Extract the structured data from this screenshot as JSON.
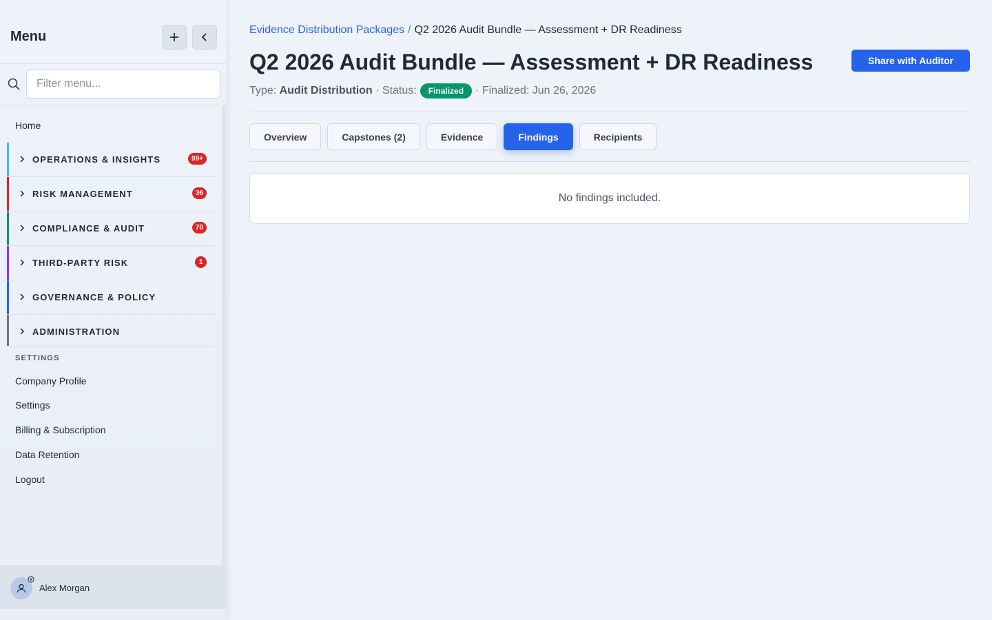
{
  "sidebar": {
    "title": "Menu",
    "search_placeholder": "Filter menu...",
    "home_label": "Home",
    "groups": [
      {
        "label": "OPERATIONS & INSIGHTS",
        "badge": "99+",
        "color": "#38bdf8"
      },
      {
        "label": "RISK MANAGEMENT",
        "badge": "36",
        "color": "#dc2626"
      },
      {
        "label": "COMPLIANCE & AUDIT",
        "badge": "70",
        "color": "#059669"
      },
      {
        "label": "THIRD-PARTY RISK",
        "badge": "1",
        "color": "#9333ea"
      },
      {
        "label": "GOVERNANCE & POLICY",
        "badge": "",
        "color": "#2563eb"
      },
      {
        "label": "ADMINISTRATION",
        "badge": "",
        "color": "#6b7280"
      }
    ],
    "settings_heading": "SETTINGS",
    "settings_items": [
      "Company Profile",
      "Settings",
      "Billing & Subscription",
      "Data Retention",
      "Logout"
    ],
    "user_name": "Alex Morgan"
  },
  "breadcrumb": {
    "parent": "Evidence Distribution Packages",
    "separator": "/",
    "current": "Q2 2026 Audit Bundle — Assessment + DR Readiness"
  },
  "page": {
    "title": "Q2 2026 Audit Bundle — Assessment + DR Readiness",
    "share_label": "Share with Auditor",
    "type_label": "Type:",
    "type_value": "Audit Distribution",
    "status_label": "· Status:",
    "status_value": "Finalized",
    "finalized_text": "· Finalized: Jun 26, 2026"
  },
  "tabs": [
    {
      "label": "Overview",
      "active": false
    },
    {
      "label": "Capstones (2)",
      "active": false
    },
    {
      "label": "Evidence",
      "active": false
    },
    {
      "label": "Findings",
      "active": true
    },
    {
      "label": "Recipients",
      "active": false
    }
  ],
  "panel": {
    "empty_text": "No findings included."
  },
  "colors": {
    "accent": "#2563eb",
    "status_green": "#059669",
    "badge_red": "#dc2626"
  }
}
